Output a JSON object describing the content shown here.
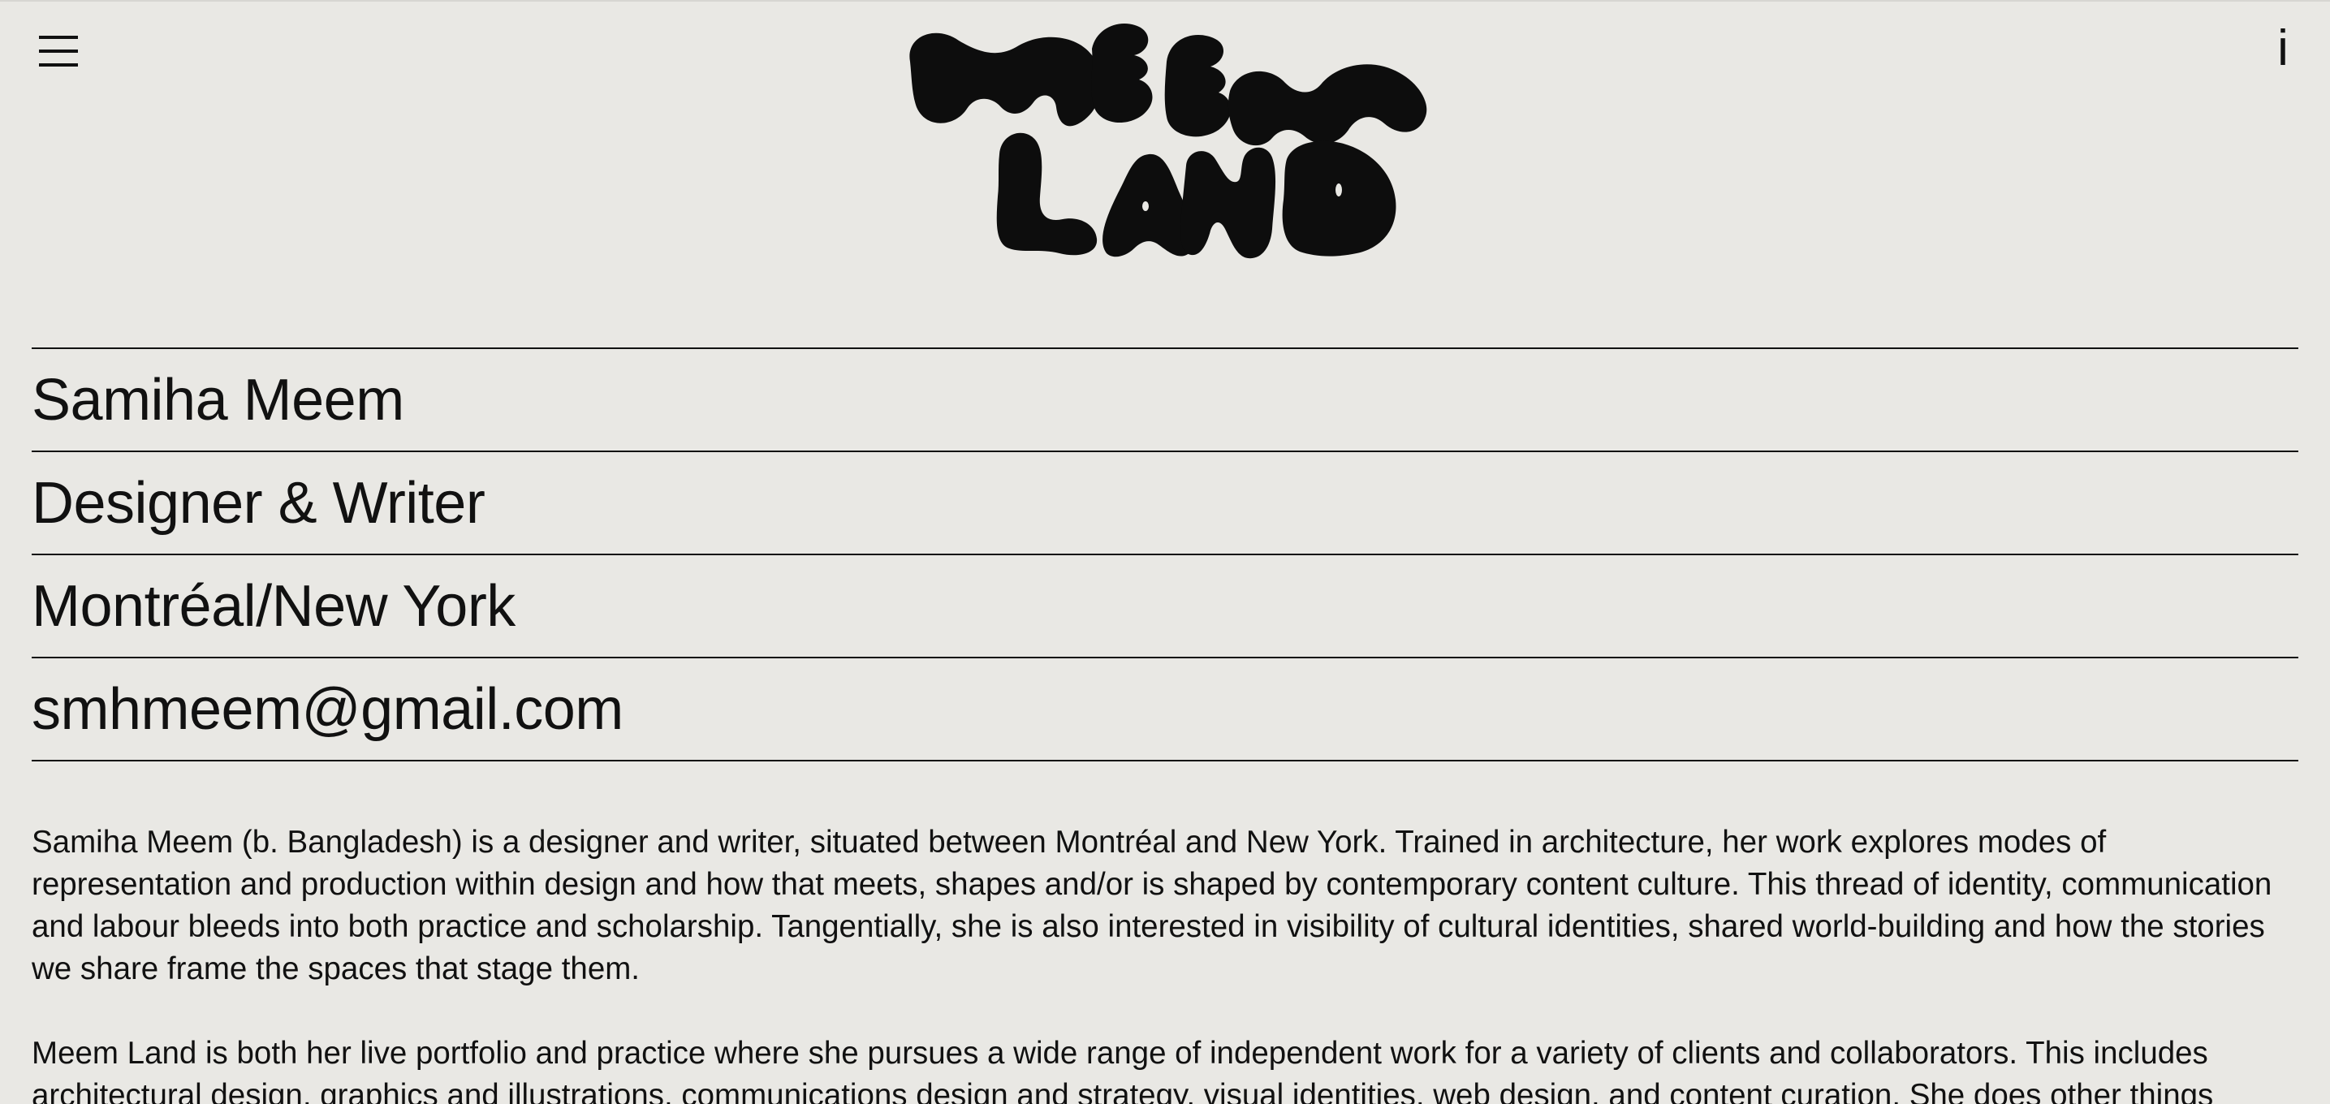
{
  "header": {
    "menu_icon": "hamburger-menu-icon",
    "info_label": "i",
    "logo_text": "MEEM LAND"
  },
  "info": {
    "name": "Samiha Meem",
    "role": "Designer & Writer",
    "location": "Montréal/New York",
    "email": "smhmeem@gmail.com"
  },
  "bio": {
    "paragraph_1": "Samiha Meem (b. Bangladesh) is a designer and writer, situated between Montréal and New York. Trained in architecture, her work explores modes of representation and production within design and how that meets, shapes and/or is shaped by contemporary content culture. This thread of identity, communication and labour bleeds into both practice and scholarship. Tangentially, she is also interested in visibility of cultural identities, shared world-building and how the stories we share frame the spaces that stage them.",
    "paragraph_2": "Meem Land is both her live portfolio and practice where she pursues a wide range of independent work for a variety of clients and collaborators. This includes architectural design, graphics and illustrations, communications design and strategy, visual identities, web design, and content curation. She does other things"
  },
  "colors": {
    "background": "#e9e8e4",
    "ink": "#111111"
  }
}
